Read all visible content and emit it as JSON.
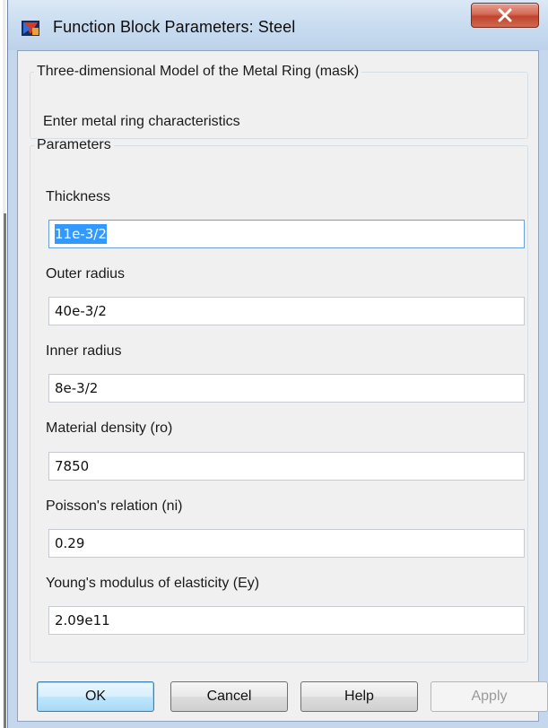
{
  "window": {
    "title": "Function Block Parameters: Steel",
    "icons": {
      "app": "simulink-block-icon",
      "close": "close-icon"
    }
  },
  "description_group": {
    "legend": "Three-dimensional Model of the Metal Ring (mask)",
    "text": "Enter metal ring characteristics"
  },
  "parameters": {
    "legend": "Parameters",
    "fields": [
      {
        "label": "Thickness",
        "value": "11e-3/2",
        "selected": true
      },
      {
        "label": "Outer radius",
        "value": "40e-3/2"
      },
      {
        "label": "Inner radius",
        "value": "8e-3/2"
      },
      {
        "label": "Material density (ro)",
        "value": "7850"
      },
      {
        "label": "Poisson's relation (ni)",
        "value": "0.29"
      },
      {
        "label": "Young's modulus of elasticity (Ey)",
        "value": "2.09e11"
      }
    ]
  },
  "buttons": {
    "ok": "OK",
    "cancel": "Cancel",
    "help": "Help",
    "apply": "Apply",
    "apply_enabled": false
  },
  "colors": {
    "frame": "#c4d7ec",
    "client": "#f0f0f0",
    "close_button": "#c7513a",
    "selection": "#3399ff",
    "default_button": "#bee6fd"
  }
}
